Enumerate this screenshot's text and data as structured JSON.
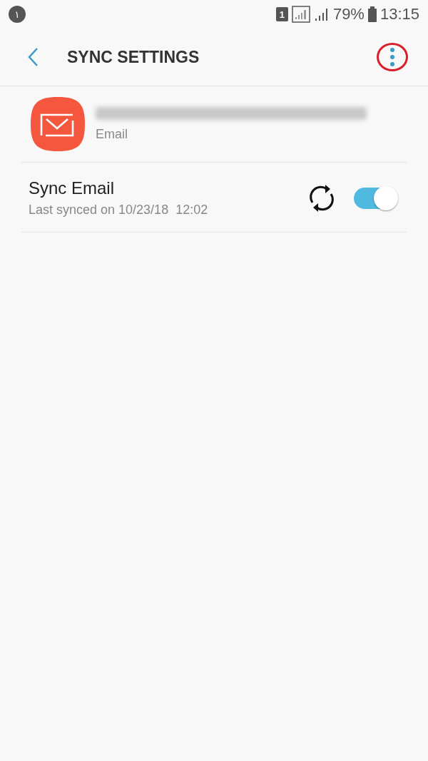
{
  "status_bar": {
    "notification_badge": "١",
    "sim_label": "1",
    "battery": "79%",
    "time": "13:15"
  },
  "app_bar": {
    "title": "SYNC SETTINGS",
    "menu_highlighted": true
  },
  "account": {
    "type": "Email"
  },
  "sync_items": [
    {
      "title": "Sync Email",
      "subtitle": "Last synced on 10/23/18  12:02",
      "on": true
    }
  ]
}
